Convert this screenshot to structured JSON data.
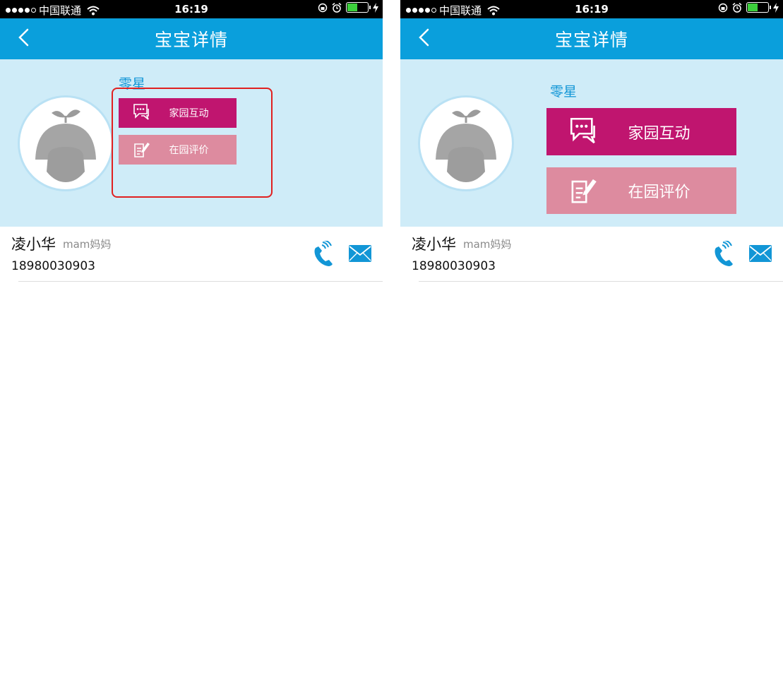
{
  "status": {
    "carrier": "中国联通",
    "time": "16:19"
  },
  "nav": {
    "title": "宝宝详情"
  },
  "child": {
    "name": "零星"
  },
  "actions": {
    "interact_label": "家园互动",
    "evaluate_label": "在园评价"
  },
  "contact": {
    "name": "凌小华",
    "relation": "mam妈妈",
    "phone": "18980030903"
  },
  "colors": {
    "nav_bg": "#0a9fdc",
    "profile_bg": "#cfecf8",
    "interact_btn": "#c0156f",
    "evaluate_btn": "#dd8b9f",
    "highlight": "#e02020",
    "accent_blue": "#1296d6"
  }
}
